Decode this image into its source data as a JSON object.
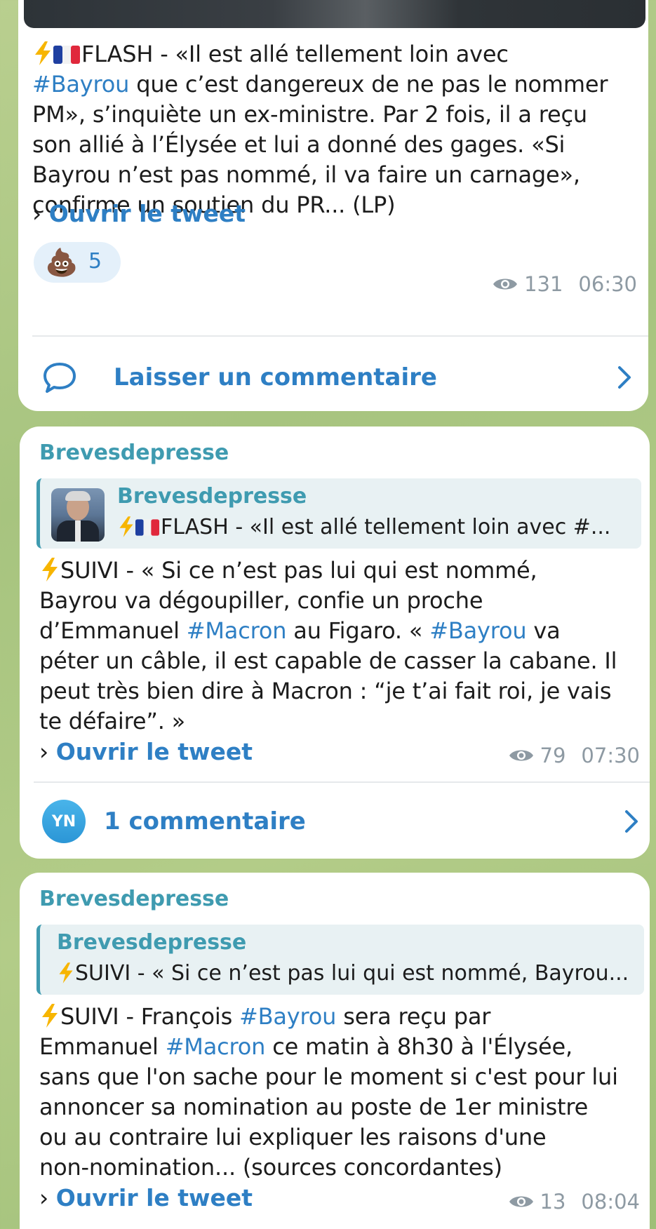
{
  "messages": [
    {
      "text_lines": [
        "FLASH - «Il est allé tellement loin avec",
        " que c’est dangereux de ne pas le nommer",
        "PM», s’inquiète un ex-ministre. Par 2 fois, il a reçu",
        "son allié à l’Élysée et lui a donné des gages. «Si",
        "Bayrou n’est pas nommé, il va faire un carnage»,",
        "confirme un soutien du PR... (LP)"
      ],
      "hashtag_1": "#Bayrou",
      "open_tweet": "Ouvrir le tweet",
      "reaction_emoji": "💩",
      "reaction_count": "5",
      "views": "131",
      "time": "06:30",
      "comment_label": "Laisser un commentaire"
    },
    {
      "sender": "Brevesdepresse",
      "quote_sender": "Brevesdepresse",
      "quote_text": "FLASH - «Il est allé tellement loin avec #...",
      "text_lines": [
        "SUIVI - « Si ce n’est pas lui qui est nommé,",
        "Bayrou va dégoupiller, confie un proche",
        "d’Emmanuel ",
        " au Figaro. « ",
        " va",
        "péter un câble, il est capable de casser la cabane. Il",
        "peut très bien dire à Macron : “je t’ai fait roi, je vais",
        "te défaire”. »"
      ],
      "hashtag_macron": "#Macron",
      "hashtag_bayrou": "#Bayrou",
      "open_tweet": "Ouvrir le tweet",
      "views": "79",
      "time": "07:30",
      "commenter_initials": "YN",
      "comment_label": "1 commentaire"
    },
    {
      "sender": "Brevesdepresse",
      "quote_sender": "Brevesdepresse",
      "quote_text": "SUIVI - « Si ce n’est pas lui qui est nommé, Bayrou...",
      "text_lines": [
        "SUIVI - François ",
        " sera reçu par",
        "Emmanuel ",
        " ce matin à 8h30 à l'Élysée,",
        "sans que l'on sache pour le moment si c'est pour lui",
        "annoncer sa nomination au poste de 1er ministre",
        "ou au contraire lui expliquer les raisons d'une",
        "non-nomination... (sources concordantes)"
      ],
      "hashtag_bayrou": "#Bayrou",
      "hashtag_macron": "#Macron",
      "open_tweet": "Ouvrir le tweet",
      "views": "13",
      "time": "08:04"
    }
  ],
  "colors": {
    "link": "#2e7fc4",
    "sender": "#3f9bb0",
    "meta": "#8e9aa3",
    "background": "#a9c681"
  },
  "icons": {
    "eye": "eye-icon",
    "chevron": "chevron-right-icon",
    "comment": "comment-bubble-icon",
    "bolt": "lightning-icon",
    "flag": "france-flag-icon"
  }
}
